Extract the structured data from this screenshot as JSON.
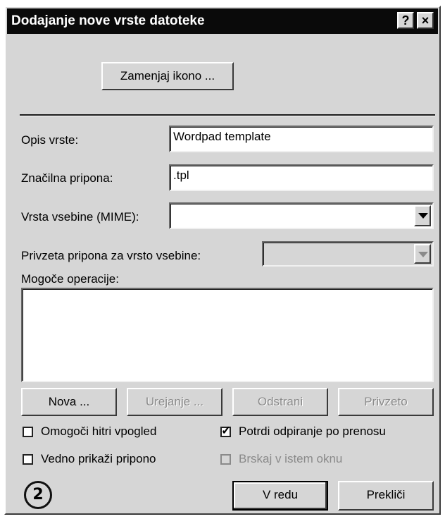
{
  "window": {
    "title": "Dodajanje nove vrste datoteke",
    "help_glyph": "?",
    "close_glyph": "×"
  },
  "change_icon_button": "Zamenjaj ikono ...",
  "fields": {
    "description_label": "Opis vrste:",
    "description_value": "Wordpad template",
    "extension_label": "Značilna pripona:",
    "extension_value": ".tpl",
    "mime_label": "Vrsta vsebine (MIME):",
    "mime_value": "",
    "default_ext_label": "Privzeta pripona za vrsto vsebine:",
    "default_ext_value": ""
  },
  "actions": {
    "label": "Mogoče operacije:",
    "items": []
  },
  "action_buttons": {
    "new": "Nova ...",
    "edit": "Urejanje ...",
    "remove": "Odstrani",
    "default": "Privzeto"
  },
  "checkboxes": {
    "quick_view": {
      "label": "Omogoči hitri vpogled",
      "checked": false,
      "enabled": true
    },
    "confirm_open": {
      "label": "Potrdi odpiranje po prenosu",
      "checked": true,
      "enabled": true
    },
    "always_show_ext": {
      "label": "Vedno prikaži pripono",
      "checked": false,
      "enabled": true
    },
    "browse_same_window": {
      "label": "Brskaj v istem oknu",
      "checked": false,
      "enabled": false
    }
  },
  "footer": {
    "badge": "2",
    "ok": "V redu",
    "cancel": "Prekliči"
  }
}
